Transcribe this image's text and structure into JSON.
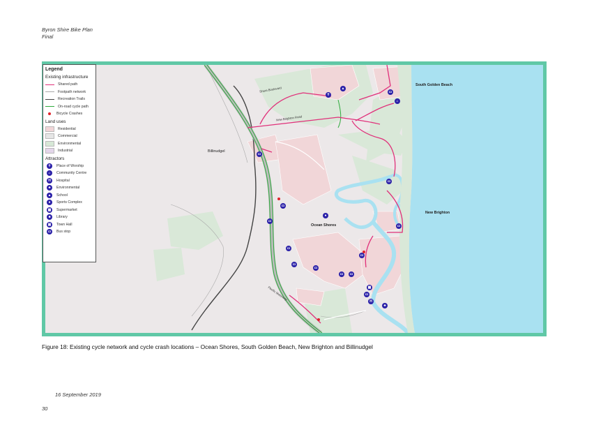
{
  "header": {
    "line1": "Byron Shire Bike Plan",
    "line2": "Final"
  },
  "legend": {
    "title": "Legend",
    "sections": {
      "infrastructure": "Existing infrastructure",
      "land_uses": "Land uses",
      "attractors": "Attractors"
    },
    "infrastructure": [
      {
        "label": "Shared path",
        "color": "#e0307a"
      },
      {
        "label": "Footpath network",
        "color": "#a9a9a9"
      },
      {
        "label": "Recreation Trails",
        "color": "#444444"
      },
      {
        "label": "On-road cycle path",
        "color": "#2eaa3c"
      },
      {
        "label": "Bicycle Crashes",
        "color": "#e0242c"
      }
    ],
    "land_uses": [
      {
        "label": "Residential",
        "color": "#f1d6d8"
      },
      {
        "label": "Commercial",
        "color": "#e6e6e6"
      },
      {
        "label": "Environmental",
        "color": "#d6e8d6"
      },
      {
        "label": "Industrial",
        "color": "#e3d6ea"
      }
    ],
    "attractors": [
      {
        "label": "Place of Worship",
        "icon": "place-of-worship-icon",
        "glyph": "✝"
      },
      {
        "label": "Community Centre",
        "icon": "community-centre-icon",
        "glyph": "⌂"
      },
      {
        "label": "Hospital",
        "icon": "hospital-icon",
        "glyph": "H"
      },
      {
        "label": "Environmental",
        "icon": "environmental-icon",
        "glyph": "♣"
      },
      {
        "label": "School",
        "icon": "school-icon",
        "glyph": "▲"
      },
      {
        "label": "Sports Complex",
        "icon": "sports-complex-icon",
        "glyph": "●"
      },
      {
        "label": "Supermarket",
        "icon": "supermarket-icon",
        "glyph": "▦"
      },
      {
        "label": "Library",
        "icon": "library-icon",
        "glyph": "■"
      },
      {
        "label": "Town Hall",
        "icon": "town-hall-icon",
        "glyph": "▣"
      },
      {
        "label": "Bus stop",
        "icon": "bus-stop-icon",
        "glyph": "▭"
      }
    ]
  },
  "map": {
    "places": {
      "south_golden_beach": "South Golden Beach",
      "billinudgel": "Billinudgel",
      "ocean_shores": "Ocean Shores",
      "new_brighton": "New Brighton"
    },
    "roads": {
      "shara_boulevard": "Shara Boulevard",
      "new_brighton_road": "New Brighton Road",
      "pacific_motorway": "Pacific Motorway"
    },
    "colors": {
      "ocean": "#a9e1f1",
      "land": "#ece8e9",
      "frame": "#60c8a6"
    }
  },
  "caption": "Figure 18: Existing cycle network and cycle crash locations – Ocean Shores, South Golden Beach, New Brighton and Billinudgel",
  "footer": {
    "date": "16 September 2019",
    "page": "30"
  }
}
